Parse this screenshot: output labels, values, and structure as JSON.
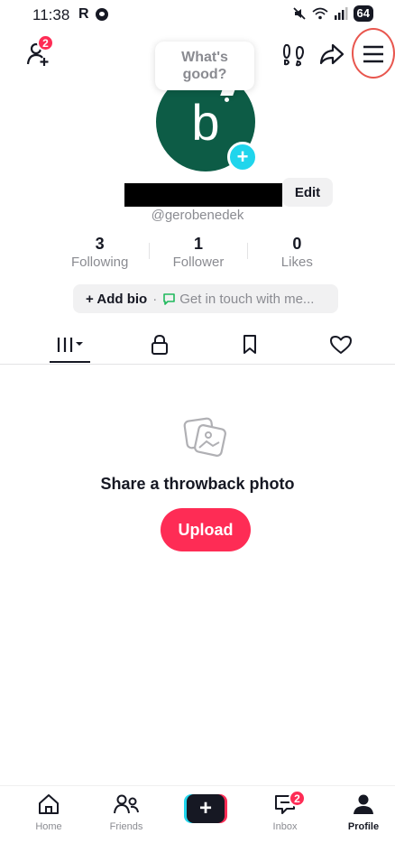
{
  "status_bar": {
    "time": "11:38",
    "carrier_letter": "R",
    "battery": "64"
  },
  "header": {
    "friend_requests_badge": "2",
    "menu_icon": "hamburger-menu-icon"
  },
  "profile": {
    "note_bubble": "What's good?",
    "avatar_letter": "b",
    "edit_label": "Edit",
    "username": "@gerobenedek",
    "stats": [
      {
        "value": "3",
        "label": "Following"
      },
      {
        "value": "1",
        "label": "Follower"
      },
      {
        "value": "0",
        "label": "Likes"
      }
    ],
    "add_bio_label": "+ Add bio",
    "bio_separator": "·",
    "contact_label": "Get in touch with me..."
  },
  "empty_state": {
    "title": "Share a throwback photo",
    "upload_label": "Upload"
  },
  "bottom_nav": {
    "home": "Home",
    "friends": "Friends",
    "create": "+",
    "inbox": "Inbox",
    "inbox_badge": "2",
    "profile": "Profile"
  },
  "colors": {
    "accent": "#fe2c55",
    "avatar_bg": "#0d5c46",
    "cyan": "#20d5ec",
    "highlight_ring": "#e8564e"
  }
}
